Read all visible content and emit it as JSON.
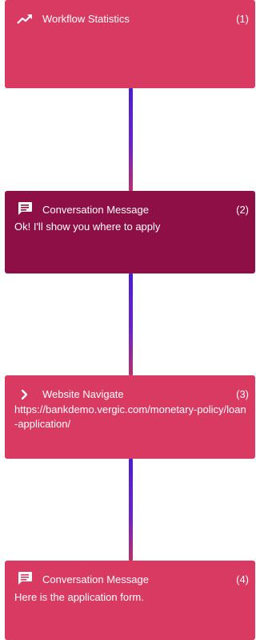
{
  "nodes": [
    {
      "title": "Workflow Statistics",
      "index": "(1)",
      "body": "",
      "icon": "trending-up-icon",
      "selected": false
    },
    {
      "title": "Conversation Message",
      "index": "(2)",
      "body": "Ok! I'll show you where to apply",
      "icon": "chat-message-icon",
      "selected": true
    },
    {
      "title": "Website Navigate",
      "index": "(3)",
      "body": "https://bankdemo.vergic.com/monetary-policy/loan-application/",
      "icon": "chevron-right-icon",
      "selected": false
    },
    {
      "title": "Conversation Message",
      "index": "(4)",
      "body": "Here is the application form.",
      "icon": "chat-message-icon",
      "selected": false
    }
  ],
  "colors": {
    "node_bg": "#d93a62",
    "node_selected_bg": "#8e0f45",
    "connector": "#5a22cc",
    "text": "#ffffff"
  }
}
